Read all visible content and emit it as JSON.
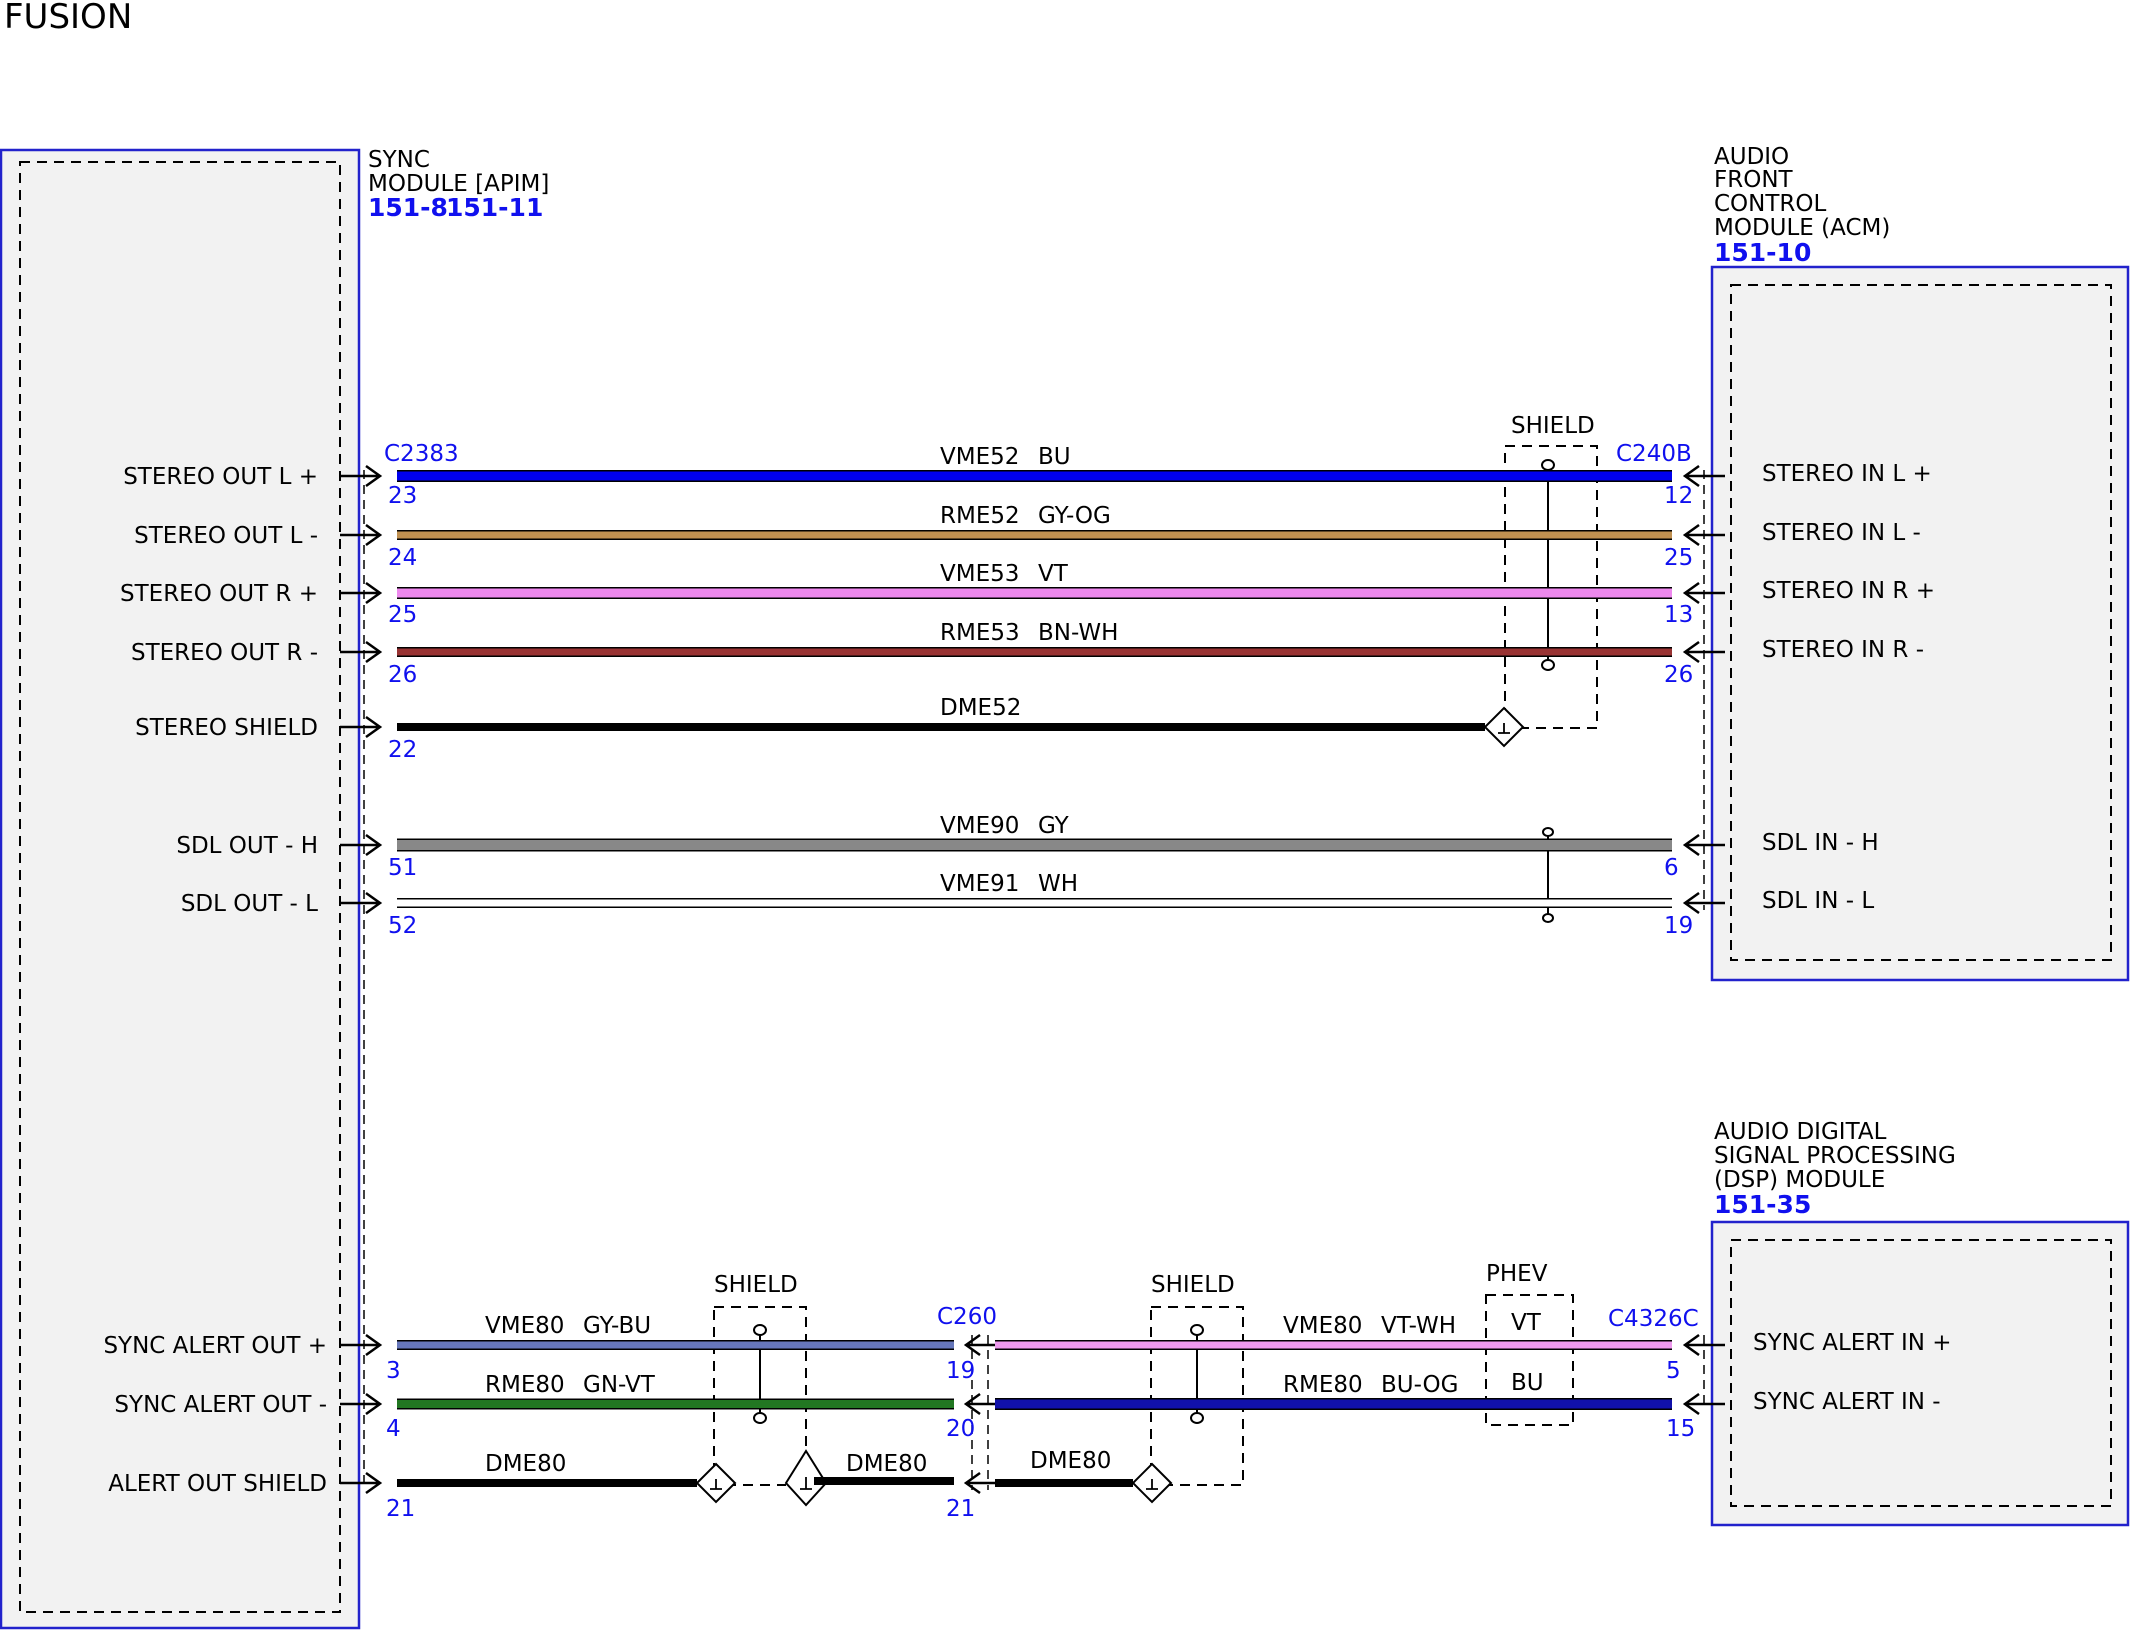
{
  "title": "FUSION",
  "colors": {
    "module_border": "#2222cc",
    "module_fill": "#f2f2f2",
    "pin_text": "#1010ee",
    "BU": "#0000ee",
    "GY-OG": "#c09050",
    "VT": "#ee88ee",
    "BN-WH": "#993333",
    "BLACK": "#000000",
    "GY": "#888888",
    "WH": "#ffffff",
    "GY-BU": "#6677bb",
    "GN-VT": "#227722",
    "VT-WH": "#ee99ee",
    "BU-OG": "#1111aa"
  },
  "modules": {
    "sync": {
      "name_lines": [
        "SYNC",
        "MODULE [APIM]"
      ],
      "refs": [
        "151-8",
        "151-11"
      ]
    },
    "acm": {
      "name_lines": [
        "AUDIO",
        "FRONT",
        "CONTROL",
        "MODULE (ACM)"
      ],
      "refs": [
        "151-10"
      ]
    },
    "dsp": {
      "name_lines": [
        "AUDIO DIGITAL",
        "SIGNAL PROCESSING",
        "(DSP) MODULE"
      ],
      "refs": [
        "151-35"
      ]
    }
  },
  "connectors": {
    "sync_top": "C2383",
    "acm": "C240B",
    "inline": "C260",
    "dsp": "C4326C"
  },
  "labels": {
    "shield": "SHIELD",
    "phev": "PHEV",
    "phev_vt": "VT",
    "phev_bu": "BU"
  },
  "circuits": [
    {
      "left_label": "STEREO OUT L +",
      "left_pin": "23",
      "right_label": "STEREO IN L +",
      "right_pin": "12",
      "circuit": "VME52",
      "color": "BU"
    },
    {
      "left_label": "STEREO OUT L -",
      "left_pin": "24",
      "right_label": "STEREO IN L -",
      "right_pin": "25",
      "circuit": "RME52",
      "color": "GY-OG"
    },
    {
      "left_label": "STEREO OUT R +",
      "left_pin": "25",
      "right_label": "STEREO IN R +",
      "right_pin": "13",
      "circuit": "VME53",
      "color": "VT"
    },
    {
      "left_label": "STEREO OUT R -",
      "left_pin": "26",
      "right_label": "STEREO IN R -",
      "right_pin": "26",
      "circuit": "RME53",
      "color": "BN-WH"
    },
    {
      "left_label": "STEREO SHIELD",
      "left_pin": "22",
      "circuit": "DME52",
      "color": ""
    },
    {
      "left_label": "SDL OUT - H",
      "left_pin": "51",
      "right_label": "SDL IN - H",
      "right_pin": "6",
      "circuit": "VME90",
      "color": "GY"
    },
    {
      "left_label": "SDL OUT - L",
      "left_pin": "52",
      "right_label": "SDL IN - L",
      "right_pin": "19",
      "circuit": "VME91",
      "color": "WH"
    }
  ],
  "alert_circuits": [
    {
      "left_label": "SYNC ALERT OUT +",
      "left_pin": "3",
      "seg1_circuit": "VME80",
      "seg1_color": "GY-BU",
      "mid_pin": "19",
      "seg2_circuit": "VME80",
      "seg2_color": "VT-WH",
      "right_pin": "5",
      "right_label": "SYNC ALERT IN +"
    },
    {
      "left_label": "SYNC ALERT OUT -",
      "left_pin": "4",
      "seg1_circuit": "RME80",
      "seg1_color": "GN-VT",
      "mid_pin": "20",
      "seg2_circuit": "RME80",
      "seg2_color": "BU-OG",
      "right_pin": "15",
      "right_label": "SYNC ALERT IN -"
    },
    {
      "left_label": "ALERT OUT SHIELD",
      "left_pin": "21",
      "seg1_circuit": "DME80",
      "seg1_mid_circuit": "DME80",
      "mid_pin": "21",
      "seg2_circuit": "DME80"
    }
  ]
}
